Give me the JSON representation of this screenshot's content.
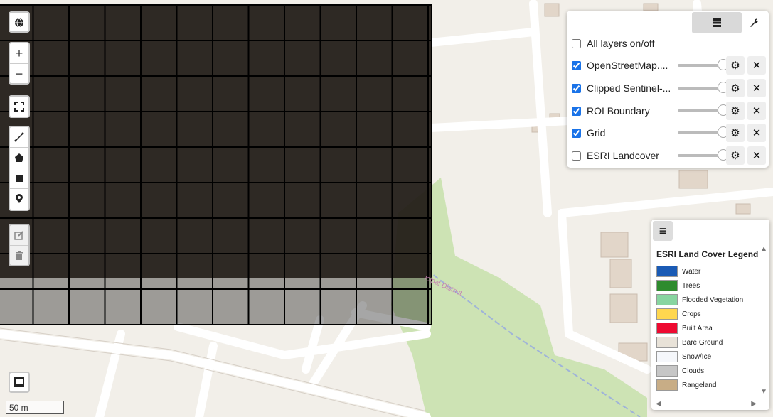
{
  "map": {
    "overlay_label": "icipal District",
    "scale_label": "50 m"
  },
  "toolbar": {
    "globe_icon": "globe-icon",
    "zoom_in": "+",
    "zoom_out": "−"
  },
  "layers_panel": {
    "all_layers_label": "All layers on/off",
    "all_layers_checked": false,
    "layers": [
      {
        "label": "OpenStreetMap....",
        "checked": true
      },
      {
        "label": "Clipped Sentinel-...",
        "checked": true
      },
      {
        "label": "ROI Boundary",
        "checked": true
      },
      {
        "label": "Grid",
        "checked": true
      },
      {
        "label": "ESRI Landcover",
        "checked": false
      }
    ]
  },
  "legend": {
    "title": "ESRI Land Cover Legend",
    "items": [
      {
        "label": "Water",
        "color": "#1a5bb5"
      },
      {
        "label": "Trees",
        "color": "#2e8b2e"
      },
      {
        "label": "Flooded Vegetation",
        "color": "#88d5a0"
      },
      {
        "label": "Crops",
        "color": "#ffd74f"
      },
      {
        "label": "Built Area",
        "color": "#ee0a31"
      },
      {
        "label": "Bare Ground",
        "color": "#e8e2d8"
      },
      {
        "label": "Snow/Ice",
        "color": "#f5f7fb"
      },
      {
        "label": "Clouds",
        "color": "#c6c6c6"
      },
      {
        "label": "Rangeland",
        "color": "#c8ad86"
      }
    ]
  }
}
